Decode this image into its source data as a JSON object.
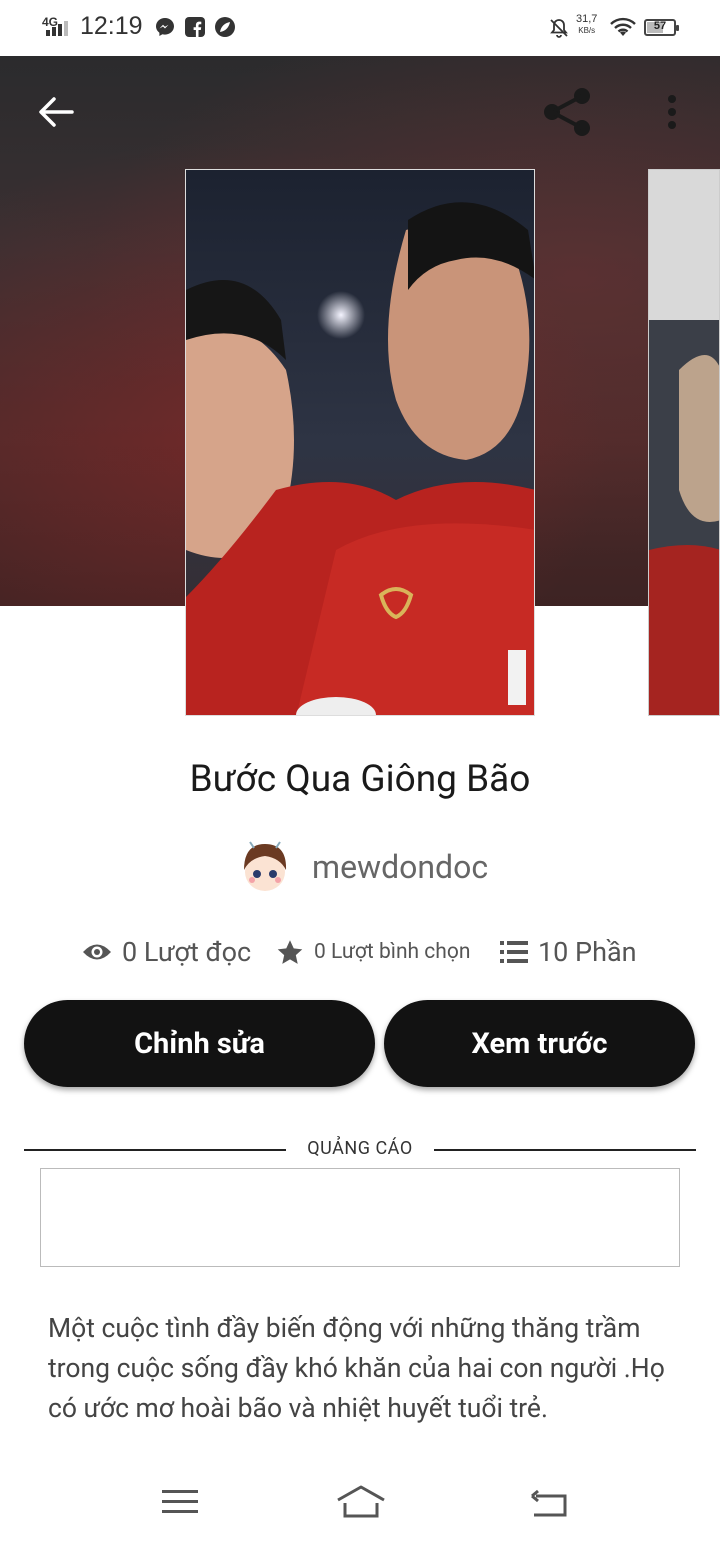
{
  "status_bar": {
    "network": "4G",
    "time": "12:19",
    "speed_value": "31,7",
    "speed_unit": "KB/s",
    "battery": "57",
    "app_icons": [
      "messenger-icon",
      "facebook-icon",
      "leaf-app-icon"
    ]
  },
  "header": {
    "back_icon": "arrow-left-icon",
    "share_icon": "share-icon",
    "more_icon": "more-vertical-icon"
  },
  "story": {
    "title": "Bước Qua Giông Bão",
    "author": "mewdondoc",
    "stats": {
      "reads": "0 Lượt đọc",
      "votes": "0 Lượt bình chọn",
      "parts": "10 Phần"
    },
    "description": "Một cuộc tình đầy biến động với những thăng trầm trong cuộc sống đầy khó khăn của hai con người .Họ có ước mơ hoài bão và nhiệt huyết tuổi trẻ."
  },
  "actions": {
    "edit_label": "Chỉnh sửa",
    "preview_label": "Xem trước"
  },
  "ad": {
    "label": "QUẢNG CÁO"
  },
  "colors": {
    "button_bg": "#121212",
    "button_text": "#ffffff",
    "text_secondary": "#555555"
  }
}
